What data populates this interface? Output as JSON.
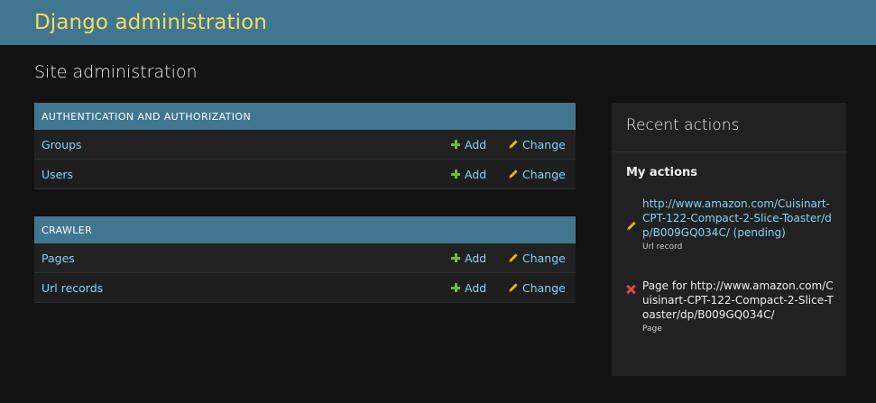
{
  "header": {
    "brand": "Django administration"
  },
  "page_title": "Site administration",
  "modules": [
    {
      "caption": "Authentication and Authorization",
      "models": [
        {
          "name": "Groups",
          "add": "Add",
          "change": "Change"
        },
        {
          "name": "Users",
          "add": "Add",
          "change": "Change"
        }
      ]
    },
    {
      "caption": "Crawler",
      "models": [
        {
          "name": "Pages",
          "add": "Add",
          "change": "Change"
        },
        {
          "name": "Url records",
          "add": "Add",
          "change": "Change"
        }
      ]
    }
  ],
  "recent_actions": {
    "title": "Recent actions",
    "subtitle": "My actions",
    "items": [
      {
        "icon": "pencil-icon",
        "text": "http://www.amazon.com/Cuisinart-CPT-122-Compact-2-Slice-Toaster/dp/B009GQ034C/ (pending)",
        "type": "Url record"
      },
      {
        "icon": "delete-icon",
        "text": "Page for http://www.amazon.com/Cuisinart-CPT-122-Compact-2-Slice-Toaster/dp/B009GQ034C/",
        "type": "Page"
      }
    ]
  },
  "colors": {
    "header_bg": "#417690",
    "brand": "#f5dd5d",
    "link": "#81d4fa",
    "add_green": "#70bf2b",
    "pencil_yellow": "#efb80b",
    "delete_red": "#dd4646",
    "background": "#121212"
  }
}
